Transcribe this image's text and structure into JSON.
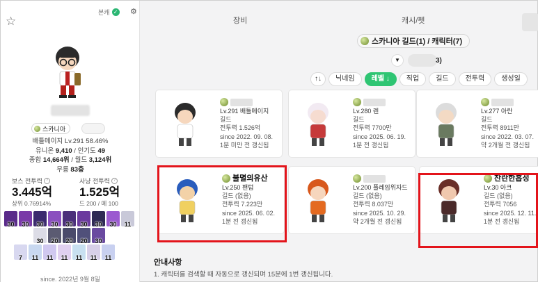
{
  "left": {
    "main_badge": "본캐",
    "server": "스카니아",
    "job_level": "배틀메이지 Lv.291 58.46%",
    "union": "유니온",
    "union_val": "9,410",
    "pop": "인기도",
    "pop_val": "49",
    "overall": "종합",
    "overall_val": "14,664위",
    "world": "월드",
    "world_val": "3,124위",
    "mureung": "무릉",
    "mureung_val": "83층",
    "boss_label": "보스 전투력",
    "boss_val": "3.445억",
    "boss_sub": "상위 0.76914%",
    "hunt_label": "사냥 전투력",
    "hunt_val": "1.525억",
    "hunt_sub": "드 200 / 메 100",
    "skills_row1": [
      "30",
      "30",
      "30",
      "30",
      "30",
      "30",
      "30",
      "30",
      "11"
    ],
    "skills_row2": [
      "30",
      "20",
      "20",
      "20",
      "30"
    ],
    "skills_row3": [
      "7",
      "11",
      "11",
      "11",
      "11",
      "11",
      "11"
    ],
    "since": "since. 2022년 9월 8일"
  },
  "right": {
    "tabs": [
      "장비",
      "캐시/펫"
    ],
    "header": "스카니아 길드(1) / 캐릭터(7)",
    "filter_count": "3)",
    "sorts": [
      "↑↓",
      "닉네임",
      "레벨 ↓",
      "직업",
      "길드",
      "전투력",
      "생성일"
    ],
    "cards": [
      {
        "name": "",
        "lv": "Lv.291 배틀메이지",
        "guild": "길드",
        "power": "전투력 1.526억",
        "since": "since 2022. 09. 08.",
        "upd": "1분 미만 전 갱신됨"
      },
      {
        "name": "",
        "lv": "Lv.280 렌",
        "guild": "길드",
        "power": "전투력 7700만",
        "since": "since 2025. 06. 19.",
        "upd": "1분 전 갱신됨"
      },
      {
        "name": "",
        "lv": "Lv.277 아란",
        "guild": "길드",
        "power": "전투력 8911만",
        "since": "since 2022. 03. 07.",
        "upd": "약 2개월 전 갱신됨"
      },
      {
        "name": "불멸의유산",
        "lv": "Lv.250 팬텀",
        "guild": "길드 (없음)",
        "power": "전투력 7.223만",
        "since": "since 2025. 06. 02.",
        "upd": "1분 전 갱신됨"
      },
      {
        "name": "",
        "lv": "Lv.200 플레임위자드",
        "guild": "길드 (없음)",
        "power": "전투력 8.037만",
        "since": "since 2025. 10. 29.",
        "upd": "약 2개월 전 갱신됨"
      },
      {
        "name": "찬란한흡성",
        "lv": "Lv.30 아크",
        "guild": "길드 (없음)",
        "power": "전투력 7056",
        "since": "since 2025. 12. 11.",
        "upd": "1분 전 갱신됨"
      }
    ],
    "notice_title": "안내사항",
    "notice_line": "1. 캐릭터를 검색할 때 자동으로 갱신되며 15분에 1번 갱신됩니다."
  }
}
